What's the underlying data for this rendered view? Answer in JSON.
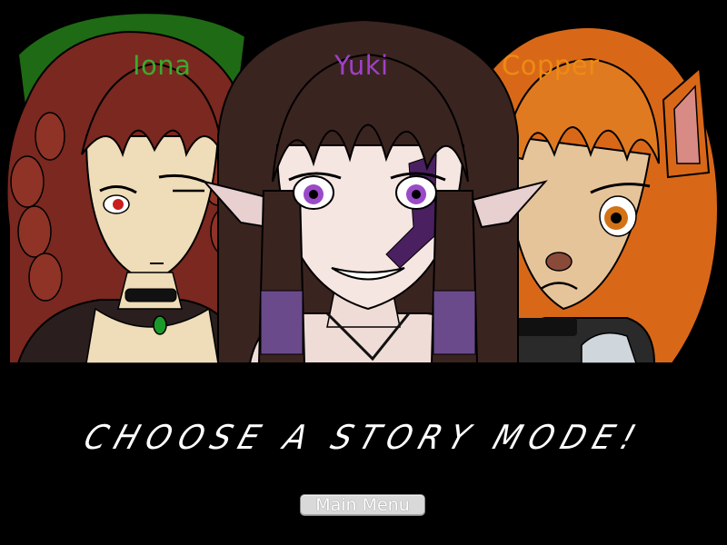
{
  "characters": [
    {
      "name": "Iona",
      "color": "#3caa2c"
    },
    {
      "name": "Yuki",
      "color": "#a040c8"
    },
    {
      "name": "Copper",
      "color": "#ee8a14"
    }
  ],
  "prompt": "CHOOSE A STORY MODE!",
  "main_menu_label": "Main Menu",
  "colors": {
    "background": "#000000",
    "prompt_text": "#ffffff",
    "button_bg": "#d9d9d9",
    "iona_hair": "#7a2820",
    "yuki_hair": "#3a2420",
    "copper_hair": "#d86818"
  }
}
